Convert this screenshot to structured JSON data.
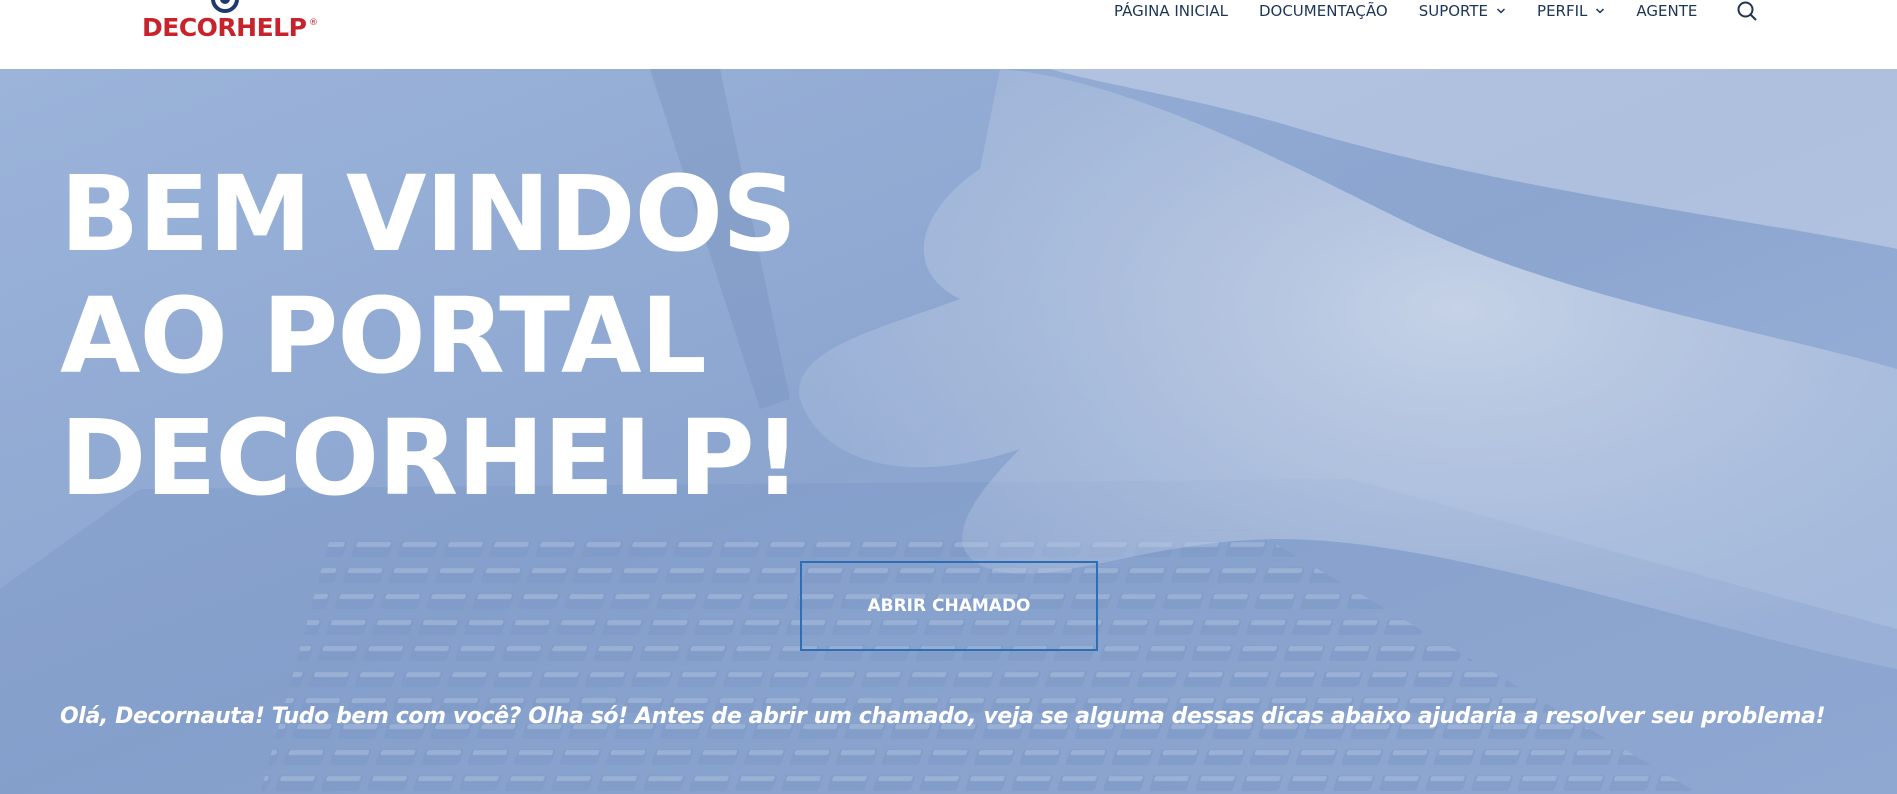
{
  "header": {
    "logo_text": "DECORHELP",
    "logo_reg": "®",
    "nav": [
      {
        "label": "PÁGINA INICIAL",
        "has_dropdown": false
      },
      {
        "label": "DOCUMENTAÇÃO",
        "has_dropdown": false
      },
      {
        "label": "SUPORTE",
        "has_dropdown": true
      },
      {
        "label": "PERFIL",
        "has_dropdown": true
      },
      {
        "label": "AGENTE",
        "has_dropdown": false
      }
    ],
    "search_icon": "search-icon"
  },
  "hero": {
    "title_lines": [
      "BEM VINDOS",
      "AO PORTAL",
      "DECORHELP!"
    ],
    "cta_label": "ABRIR CHAMADO",
    "intro_text": "Olá, Decornauta! Tudo bem com você? Olha só! Antes de abrir um chamado, veja se alguma dessas dicas abaixo ajudaria a resolver seu problema!"
  },
  "colors": {
    "brand_red": "#c8232c",
    "nav_text": "#1d3557",
    "hero_tint": "#8ea8cf",
    "cta_border": "#2f6db5"
  }
}
